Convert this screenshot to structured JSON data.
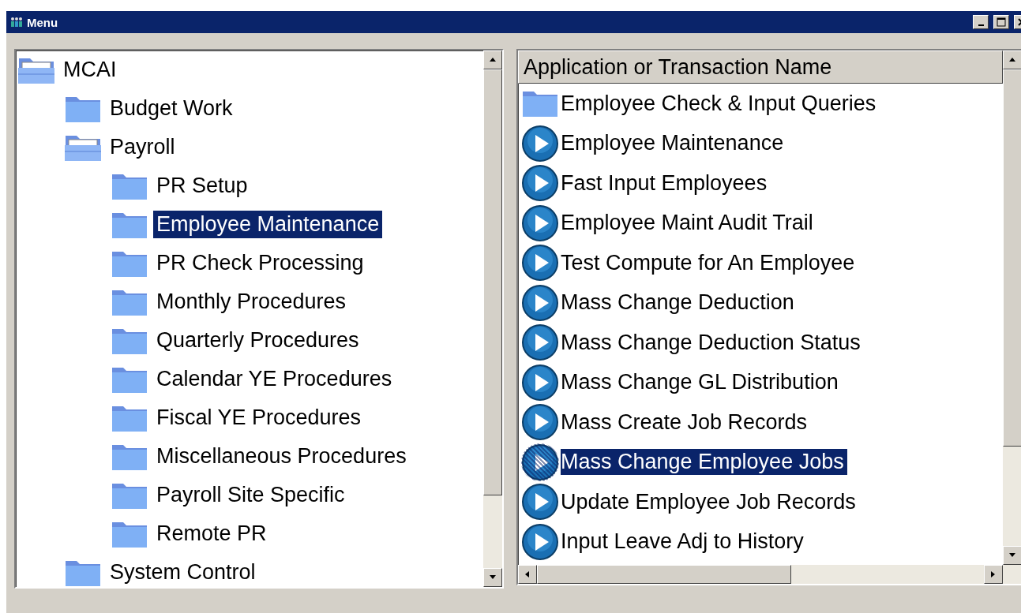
{
  "window": {
    "title": "Menu"
  },
  "tree": [
    {
      "label": "MCAI",
      "expanded": true,
      "selected": false,
      "children": [
        {
          "label": "Budget Work",
          "expanded": false,
          "selected": false
        },
        {
          "label": "Payroll",
          "expanded": true,
          "selected": false,
          "children": [
            {
              "label": "PR Setup",
              "expanded": false,
              "selected": false
            },
            {
              "label": "Employee Maintenance",
              "expanded": false,
              "selected": true
            },
            {
              "label": "PR Check Processing",
              "expanded": false,
              "selected": false
            },
            {
              "label": "Monthly Procedures",
              "expanded": false,
              "selected": false
            },
            {
              "label": "Quarterly Procedures",
              "expanded": false,
              "selected": false
            },
            {
              "label": "Calendar YE Procedures",
              "expanded": false,
              "selected": false
            },
            {
              "label": "Fiscal YE Procedures",
              "expanded": false,
              "selected": false
            },
            {
              "label": "Miscellaneous Procedures",
              "expanded": false,
              "selected": false
            },
            {
              "label": "Payroll Site Specific",
              "expanded": false,
              "selected": false
            },
            {
              "label": "Remote PR",
              "expanded": false,
              "selected": false
            }
          ]
        },
        {
          "label": "System Control",
          "expanded": false,
          "selected": false
        }
      ]
    }
  ],
  "list": {
    "header": "Application or Transaction Name",
    "items": [
      {
        "kind": "folder",
        "label": "Employee Check & Input Queries",
        "selected": false
      },
      {
        "kind": "program",
        "label": "Employee Maintenance",
        "selected": false
      },
      {
        "kind": "program",
        "label": "Fast Input Employees",
        "selected": false
      },
      {
        "kind": "program",
        "label": "Employee Maint Audit Trail",
        "selected": false
      },
      {
        "kind": "program",
        "label": "Test Compute for An Employee",
        "selected": false
      },
      {
        "kind": "program",
        "label": "Mass Change Deduction",
        "selected": false
      },
      {
        "kind": "program",
        "label": "Mass Change Deduction Status",
        "selected": false
      },
      {
        "kind": "program",
        "label": "Mass Change GL Distribution",
        "selected": false
      },
      {
        "kind": "program",
        "label": "Mass Create Job Records",
        "selected": false
      },
      {
        "kind": "program",
        "label": "Mass Change Employee Jobs",
        "selected": true
      },
      {
        "kind": "program",
        "label": "Update Employee Job Records",
        "selected": false
      },
      {
        "kind": "program",
        "label": "Input Leave Adj to History",
        "selected": false
      }
    ]
  }
}
